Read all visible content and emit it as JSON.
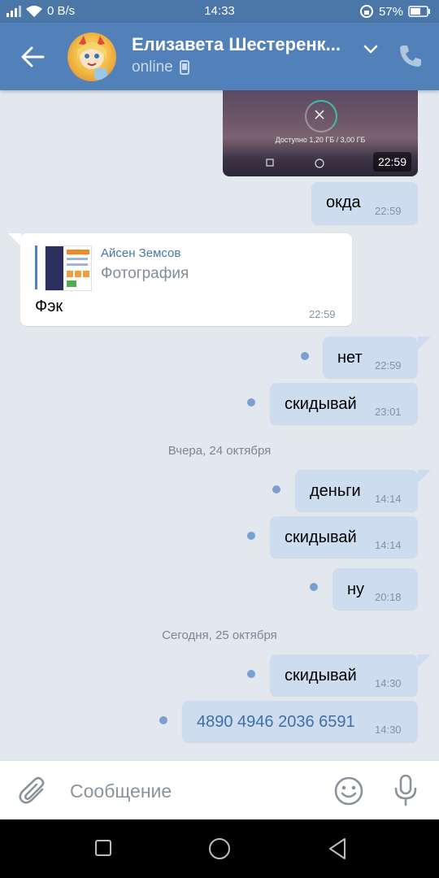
{
  "status_bar": {
    "data_rate": "0 B/s",
    "time": "14:33",
    "battery": "57%"
  },
  "header": {
    "title": "Елизавета Шестеренк...",
    "status": "online"
  },
  "media_message": {
    "caption": "Доступно 1,20 ГБ / 3,00 ГБ",
    "time": "22:59"
  },
  "messages": [
    {
      "text": "окда",
      "time": "22:59",
      "direction": "out"
    },
    {
      "text": "Фэк",
      "time": "22:59",
      "direction": "in",
      "forwarded_from": "Айсен Земсов",
      "forwarded_type": "Фотография"
    },
    {
      "text": "нет",
      "time": "22:59",
      "direction": "out"
    },
    {
      "text": "скидывай",
      "time": "23:01",
      "direction": "out"
    },
    {
      "text": "деньги",
      "time": "14:14",
      "direction": "out"
    },
    {
      "text": "скидывай",
      "time": "14:14",
      "direction": "out"
    },
    {
      "text": "ну",
      "time": "20:18",
      "direction": "out"
    },
    {
      "text": "скидывай",
      "time": "14:30",
      "direction": "out"
    },
    {
      "text": "4890 4946 2036 6591",
      "time": "14:30",
      "direction": "out",
      "link": true
    }
  ],
  "dividers": [
    "Вчера, 24 октября",
    "Сегодня, 25 октября"
  ],
  "composer": {
    "placeholder": "Сообщение"
  },
  "colors": {
    "header": "#5181b8",
    "status_bar": "#4a76a8",
    "background": "#e3e8ee",
    "outgoing_bubble": "#cddcee",
    "incoming_bubble": "#ffffff",
    "link": "#3f6fa8",
    "unread_dot": "#7a9fd0"
  },
  "icons": [
    "signal-icon",
    "wifi-icon",
    "alarm-lock-icon",
    "battery-icon",
    "back-arrow-icon",
    "chevron-down-icon",
    "phone-icon",
    "mobile-device-icon",
    "attach-icon",
    "emoji-icon",
    "mic-icon",
    "nav-square-icon",
    "nav-home-icon",
    "nav-back-icon"
  ]
}
